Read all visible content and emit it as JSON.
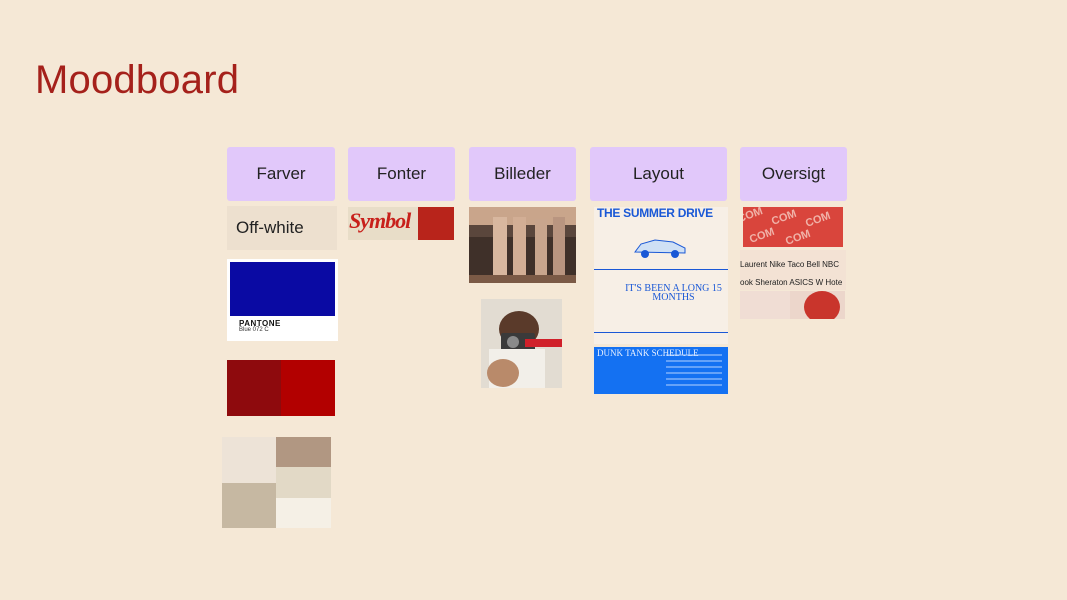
{
  "page": {
    "title": "Moodboard"
  },
  "columns": [
    {
      "label": "Farver"
    },
    {
      "label": "Fonter"
    },
    {
      "label": "Billeder"
    },
    {
      "label": "Layout"
    },
    {
      "label": "Oversigt"
    }
  ],
  "farver": {
    "offwhite_label": "Off-white",
    "pantone_name": "PANTONE",
    "pantone_code": "Blue 072 C",
    "colors": {
      "pantone_blue": "#0a0aa3",
      "red_dark": "#8e0a0d",
      "red_bright": "#b20000"
    }
  },
  "fonter": {
    "sample": "Symbol"
  },
  "layout": {
    "poster_title": "THE SUMMER DRIVE",
    "poster_headline": "IT'S BEEN A LONG 15 MONTHS",
    "schedule_title": "DUNK TANK SCHEDULE"
  },
  "oversigt": {
    "brands_row1": "Laurent  Nike  Taco Bell  NBC",
    "brands_row2": "ook  Sheraton  ASICS  W Hote"
  },
  "accent": "#a5211b"
}
